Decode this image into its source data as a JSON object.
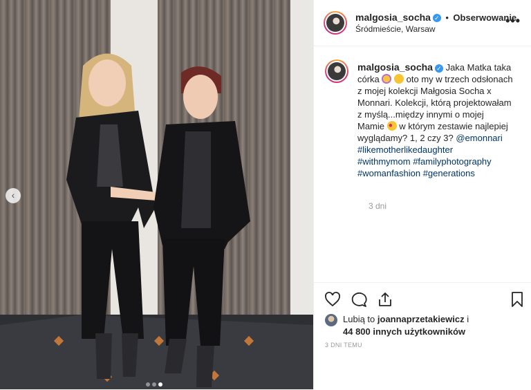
{
  "post": {
    "username": "malgosia_socha",
    "follow_label": "Obserwowanie",
    "separator": "•",
    "location": "Śródmieście, Warsaw",
    "more_label": "•••"
  },
  "caption": {
    "username": "malgosia_socha",
    "part1": "Jaka Matka taka córka",
    "part2": "oto my w trzech odsłonach z mojej kolekcji Małgosia Socha x Monnari. Kolekcji, którą projektowałam z myślą...między innymi o mojej Mamie",
    "part3": "w którym zestawie najlepiej wyglądamy? 1, 2 czy 3?",
    "mention": "@emonnari",
    "hashtags": [
      "#likemotherlikedaughter",
      "#withmymom",
      "#familyphotography",
      "#womanfashion",
      "#generations"
    ],
    "ago": "3 dni"
  },
  "likes": {
    "prefix": "Lubią to",
    "user": "joannaprzetakiewicz",
    "suffix": "i",
    "count": "44 800 innych użytkowników"
  },
  "timestamp": "3 DNI TEMU",
  "carousel": {
    "prev_label": "‹",
    "total": 3,
    "current": 3
  },
  "icons": [
    "heart-icon",
    "comment-icon",
    "share-icon",
    "bookmark-icon",
    "verified-icon"
  ],
  "colors": {
    "link": "#003569",
    "verified": "#3897f0",
    "muted": "#999999",
    "text": "#262626"
  }
}
